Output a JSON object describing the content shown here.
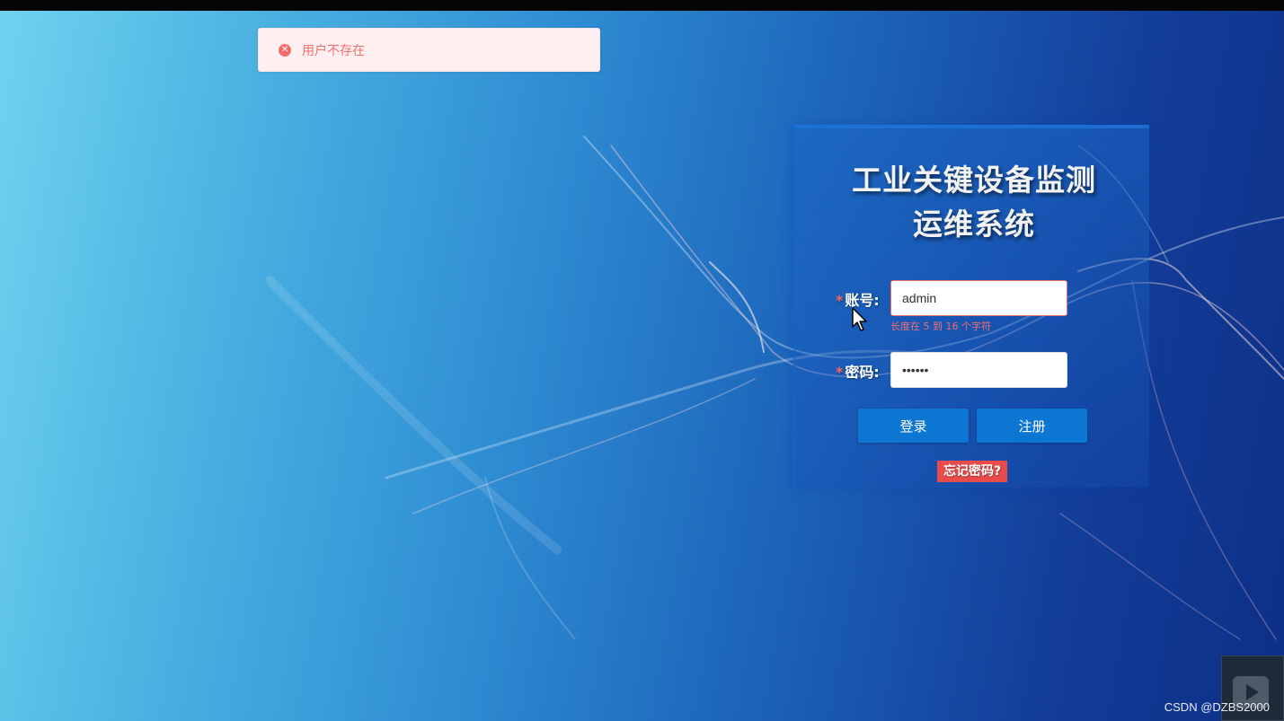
{
  "toast": {
    "icon": "error-circle-icon",
    "message": "用户不存在"
  },
  "login": {
    "title": "工业关键设备监测运维系统",
    "account": {
      "required_mark": "*",
      "label": "账号:",
      "value": "admin",
      "error": "长度在 5 到 16 个字符"
    },
    "password": {
      "required_mark": "*",
      "label": "密码:",
      "value": "••••••"
    },
    "login_button": "登录",
    "register_button": "注册",
    "forgot_link": "忘记密码?"
  },
  "watermark": "CSDN @DZBS2000",
  "colors": {
    "primary": "#0d76d2",
    "error": "#f56c6c",
    "forgot_bg": "#e84b4b"
  }
}
